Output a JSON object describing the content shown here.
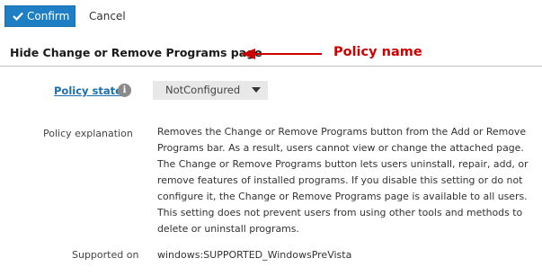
{
  "toolbar": {
    "confirm_label": "Confirm",
    "cancel_label": "Cancel",
    "confirm_icon": "check-icon",
    "accent_color": "#1f7fc4"
  },
  "policy": {
    "title": "Hide Change or Remove Programs page",
    "state_label": "Policy state",
    "state_value": "NotConfigured",
    "explanation_label": "Policy explanation",
    "explanation_lines": [
      "Removes the Change or Remove Programs button from the Add or Remove",
      "Programs bar. As a result, users cannot view or change the attached page.",
      "The Change or Remove Programs button lets users uninstall, repair, add, or",
      "remove features of installed programs. If you disable this setting or do not",
      "configure it, the Change or Remove Programs page is available to all users.",
      "This setting does not prevent users from using other tools and methods to",
      "delete or uninstall programs."
    ],
    "supported_label": "Supported on",
    "supported_value": "windows:SUPPORTED_WindowsPreVista"
  },
  "annotation": {
    "label": "Policy name",
    "color": "#cc0000"
  }
}
